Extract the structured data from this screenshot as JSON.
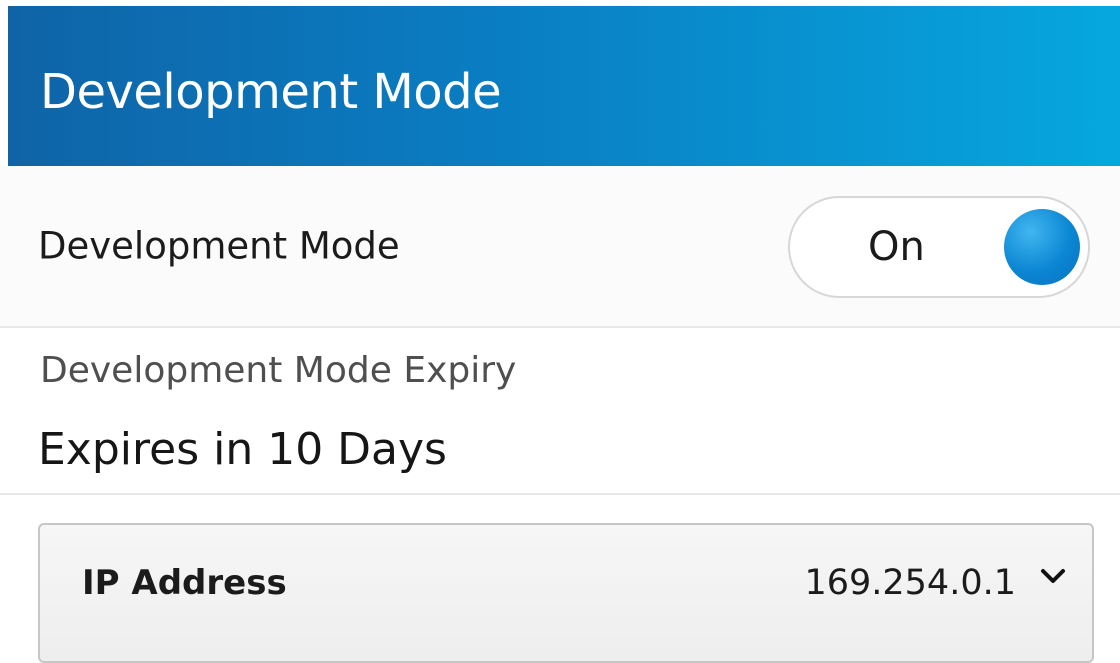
{
  "header": {
    "title": "Development Mode"
  },
  "development_mode": {
    "label": "Development Mode",
    "toggle_state": "On"
  },
  "expiry": {
    "label": "Development Mode Expiry",
    "value": "Expires in 10 Days"
  },
  "ip_address": {
    "label": "IP Address",
    "value": "169.254.0.1"
  },
  "colors": {
    "header_start": "#0f64a7",
    "header_end": "#06a7df",
    "accent": "#0b86d3"
  },
  "icons": {
    "toggle_knob": "toggle-knob-icon",
    "dropdown": "chevron-down-icon"
  }
}
